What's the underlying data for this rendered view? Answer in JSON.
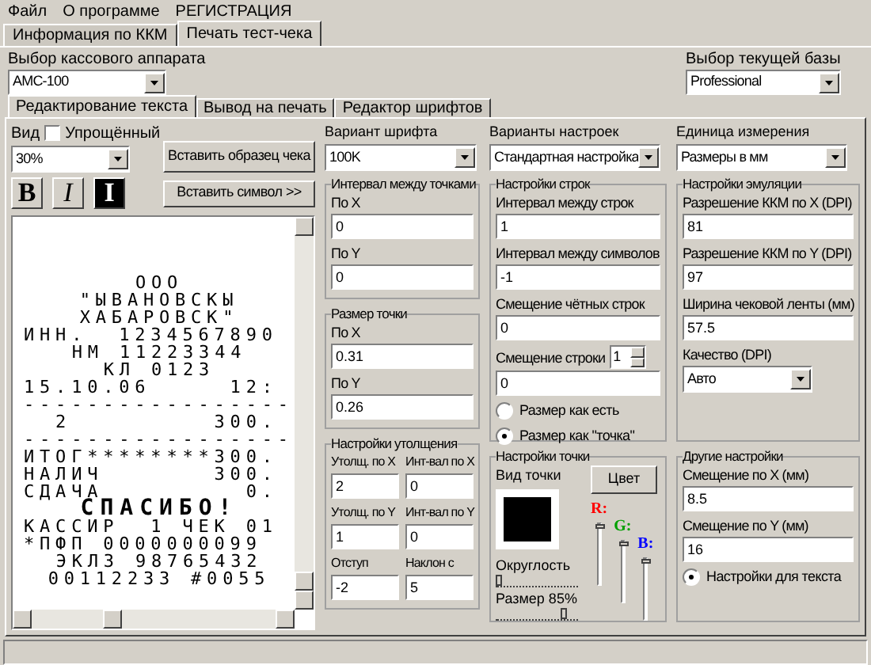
{
  "menu": [
    "Файл",
    "О программе",
    "РЕГИСТРАЦИЯ"
  ],
  "tabs": [
    {
      "label": "Информация по ККМ",
      "selected": false
    },
    {
      "label": "Печать тест-чека",
      "selected": true
    }
  ],
  "device": {
    "label": "Выбор кассового аппарата",
    "value": "АМС-100"
  },
  "base": {
    "label": "Выбор текущей базы",
    "value": "Professional"
  },
  "edit_tabs": [
    {
      "label": "Редактирование текста",
      "selected": true
    },
    {
      "label": "Вывод на печать",
      "selected": false
    },
    {
      "label": "Редактор шрифтов",
      "selected": false
    }
  ],
  "editor": {
    "view_label": "Вид",
    "simplified": {
      "label": "Упрощённый",
      "checked": false
    },
    "zoom": "30%",
    "sample_button": "Вставить образец чека",
    "symbol_button": "Вставить символ >>",
    "format_buttons": [
      {
        "label": "B",
        "kind": "bold"
      },
      {
        "label": "I",
        "kind": "italic"
      },
      {
        "label": "I",
        "kind": "inverse"
      }
    ],
    "receipt": [
      {
        "text": "ООО",
        "kind": "center"
      },
      {
        "text": "\"ЫВАНОВСКЫ",
        "kind": "center"
      },
      {
        "text": "ХАБАРОВСК\"",
        "kind": "center"
      },
      {
        "text": "ИНН.  1234567890",
        "kind": "left"
      },
      {
        "text": "НМ 11223344",
        "kind": "center"
      },
      {
        "text": "КЛ 0123",
        "kind": "center"
      },
      {
        "text": "15.10.06     12:",
        "kind": "left"
      },
      {
        "text": "-----------------",
        "kind": "left"
      },
      {
        "text": "  2         300.",
        "kind": "left"
      },
      {
        "text": "-----------------",
        "kind": "left"
      },
      {
        "text": "ИТОГ********300.",
        "kind": "left"
      },
      {
        "text": "НАЛИЧ       300.",
        "kind": "left"
      },
      {
        "text": "СДАЧА         0.",
        "kind": "left"
      },
      {
        "text": "СПАСИБО!",
        "kind": "big"
      },
      {
        "text": "КАССИР  1 ЧЕК 01",
        "kind": "left"
      },
      {
        "text": "*ПФП 0000000099",
        "kind": "left"
      },
      {
        "text": "ЭКЛЗ 98765432",
        "kind": "center"
      },
      {
        "text": "00112233 #0055",
        "kind": "center"
      }
    ]
  },
  "selects": [
    {
      "label": "Вариант шрифта",
      "value": "100K"
    },
    {
      "label": "Варианты настроек",
      "value": "Стандартная настройка"
    },
    {
      "label": "Единица измерения",
      "value": "Размеры в мм"
    }
  ],
  "columns": [
    [
      {
        "title": "Интервал между точками",
        "items": [
          {
            "kind": "field",
            "label": "По X",
            "value": "0"
          },
          {
            "kind": "field",
            "label": "По Y",
            "value": "0"
          }
        ]
      },
      {
        "title": "Размер точки",
        "items": [
          {
            "kind": "field",
            "label": "По X",
            "value": "0.31"
          },
          {
            "kind": "field",
            "label": "По Y",
            "value": "0.26"
          }
        ]
      },
      {
        "title": "Настройки утолщения",
        "items": [
          {
            "kind": "half",
            "label": "Утолщ. по X",
            "value": "2"
          },
          {
            "kind": "half",
            "label": "Инт-вал по X",
            "value": "0"
          },
          {
            "kind": "half",
            "label": "Утолщ. по Y",
            "value": "1"
          },
          {
            "kind": "half",
            "label": "Инт-вал по Y",
            "value": "0"
          },
          {
            "kind": "half",
            "label": "Отступ",
            "value": "-2"
          },
          {
            "kind": "half",
            "label": "Наклон с",
            "value": "5"
          }
        ]
      }
    ],
    [
      {
        "title": "Настройки строк",
        "items": [
          {
            "kind": "field",
            "label": "Интервал между строк",
            "value": "1"
          },
          {
            "kind": "field",
            "label": "Интервал между символов",
            "value": "-1"
          },
          {
            "kind": "field",
            "label": "Смещение чётных строк",
            "value": "0"
          },
          {
            "kind": "spin",
            "label": "Смещение строки",
            "spin": "1",
            "value": "0"
          },
          {
            "kind": "radio",
            "label": "Размер как есть",
            "selected": false
          },
          {
            "kind": "radio",
            "label": "Размер как \"точка\"",
            "selected": true
          }
        ]
      },
      {
        "title": "Настройки точки",
        "dot": {
          "view_label": "Вид точки",
          "color_button": "Цвет",
          "roundness": {
            "label": "Округлость",
            "level": 0
          },
          "size": {
            "label": "Размер 85%",
            "level": 0.85
          },
          "channels": [
            {
              "label": "R:",
              "color": "#ff0000",
              "level": 1
            },
            {
              "label": "G:",
              "color": "#00a000",
              "level": 1
            },
            {
              "label": "B:",
              "color": "#0000ff",
              "level": 1
            }
          ]
        }
      }
    ],
    [
      {
        "title": "Настройки эмуляции",
        "items": [
          {
            "kind": "field",
            "label": "Разрешение ККМ по X (DPI)",
            "value": "81"
          },
          {
            "kind": "field",
            "label": "Разрешение ККМ по Y (DPI)",
            "value": "97"
          },
          {
            "kind": "field",
            "label": "Ширина чековой ленты (мм)",
            "value": "57.5"
          },
          {
            "kind": "select",
            "label": "Качество (DPI)",
            "value": "Авто"
          }
        ]
      },
      {
        "title": "Другие настройки",
        "items": [
          {
            "kind": "field",
            "label": "Смещение по X (мм)",
            "value": "8.5"
          },
          {
            "kind": "field",
            "label": "Смещение по Y (мм)",
            "value": "16"
          },
          {
            "kind": "radio",
            "label": "Настройки для текста",
            "selected": true
          }
        ]
      }
    ]
  ]
}
